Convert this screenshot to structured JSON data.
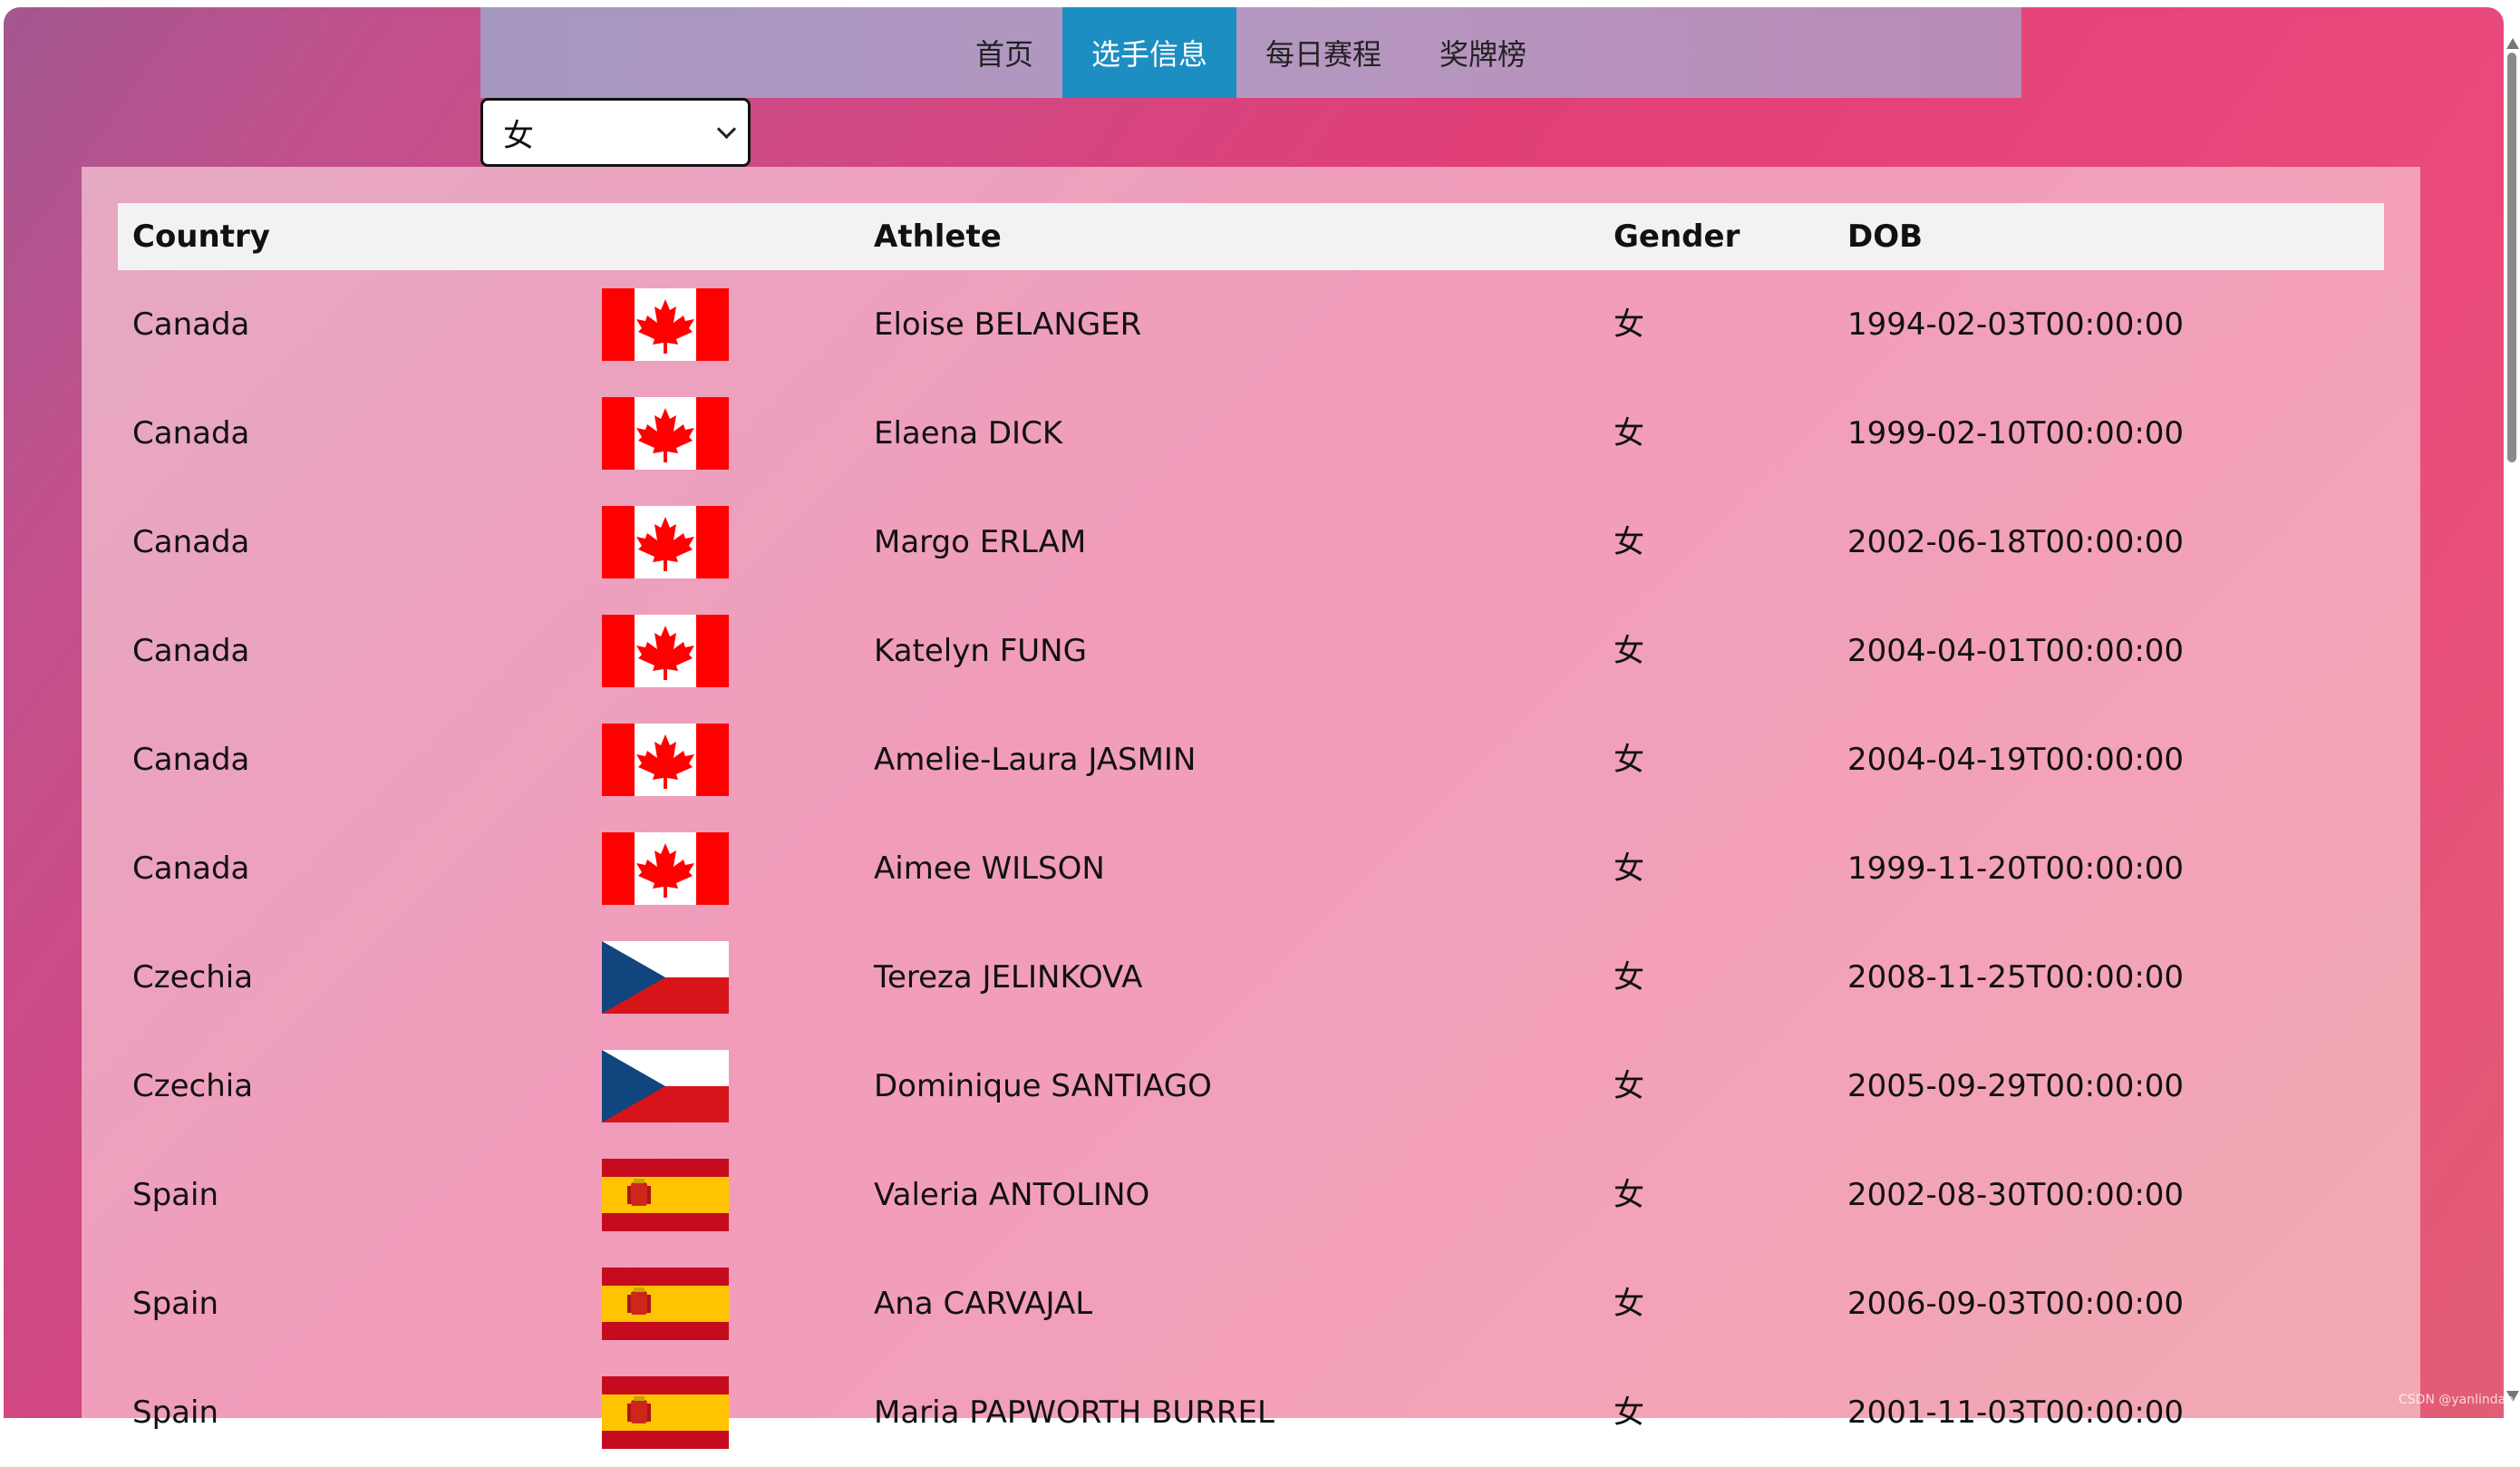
{
  "nav": {
    "items": [
      "首页",
      "选手信息",
      "每日赛程",
      "奖牌榜"
    ],
    "active_index": 1
  },
  "filter": {
    "selected": "女"
  },
  "table": {
    "headers": {
      "country": "Country",
      "athlete": "Athlete",
      "gender": "Gender",
      "dob": "DOB"
    },
    "rows": [
      {
        "country": "Canada",
        "flag": "canada-flag-icon",
        "athlete": "Eloise BELANGER",
        "gender": "女",
        "dob": "1994-02-03T00:00:00"
      },
      {
        "country": "Canada",
        "flag": "canada-flag-icon",
        "athlete": "Elaena DICK",
        "gender": "女",
        "dob": "1999-02-10T00:00:00"
      },
      {
        "country": "Canada",
        "flag": "canada-flag-icon",
        "athlete": "Margo ERLAM",
        "gender": "女",
        "dob": "2002-06-18T00:00:00"
      },
      {
        "country": "Canada",
        "flag": "canada-flag-icon",
        "athlete": "Katelyn FUNG",
        "gender": "女",
        "dob": "2004-04-01T00:00:00"
      },
      {
        "country": "Canada",
        "flag": "canada-flag-icon",
        "athlete": "Amelie-Laura JASMIN",
        "gender": "女",
        "dob": "2004-04-19T00:00:00"
      },
      {
        "country": "Canada",
        "flag": "canada-flag-icon",
        "athlete": "Aimee WILSON",
        "gender": "女",
        "dob": "1999-11-20T00:00:00"
      },
      {
        "country": "Czechia",
        "flag": "czechia-flag-icon",
        "athlete": "Tereza JELINKOVA",
        "gender": "女",
        "dob": "2008-11-25T00:00:00"
      },
      {
        "country": "Czechia",
        "flag": "czechia-flag-icon",
        "athlete": "Dominique SANTIAGO",
        "gender": "女",
        "dob": "2005-09-29T00:00:00"
      },
      {
        "country": "Spain",
        "flag": "spain-flag-icon",
        "athlete": "Valeria ANTOLINO",
        "gender": "女",
        "dob": "2002-08-30T00:00:00"
      },
      {
        "country": "Spain",
        "flag": "spain-flag-icon",
        "athlete": "Ana CARVAJAL",
        "gender": "女",
        "dob": "2006-09-03T00:00:00"
      },
      {
        "country": "Spain",
        "flag": "spain-flag-icon",
        "athlete": "Maria PAPWORTH BURREL",
        "gender": "女",
        "dob": "2001-11-03T00:00:00"
      }
    ]
  },
  "watermark": "CSDN @yanlindan",
  "colors": {
    "nav_active": "#1d8ec1",
    "header_bg": "#f2f2f2"
  }
}
